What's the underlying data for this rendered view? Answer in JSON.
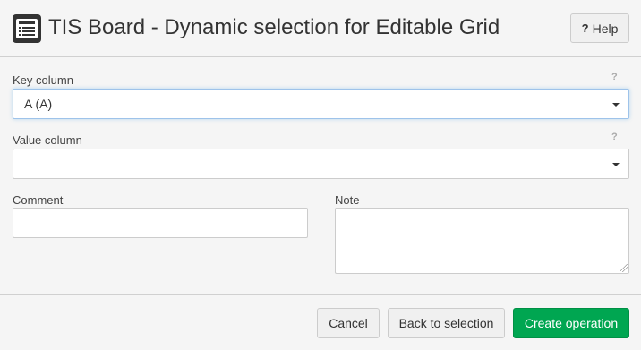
{
  "header": {
    "title": "TIS Board - Dynamic selection for Editable Grid",
    "help_icon": "?",
    "help_label": "Help",
    "app_icon": "board-list-icon"
  },
  "form": {
    "key_column": {
      "label": "Key column",
      "value": "A (A)",
      "help": "?"
    },
    "value_column": {
      "label": "Value column",
      "value": "",
      "help": "?"
    },
    "comment": {
      "label": "Comment",
      "value": ""
    },
    "note": {
      "label": "Note",
      "value": ""
    }
  },
  "footer": {
    "cancel_label": "Cancel",
    "back_label": "Back to selection",
    "create_label": "Create operation"
  },
  "colors": {
    "primary": "#00a651",
    "focus": "#9ec3ea"
  }
}
